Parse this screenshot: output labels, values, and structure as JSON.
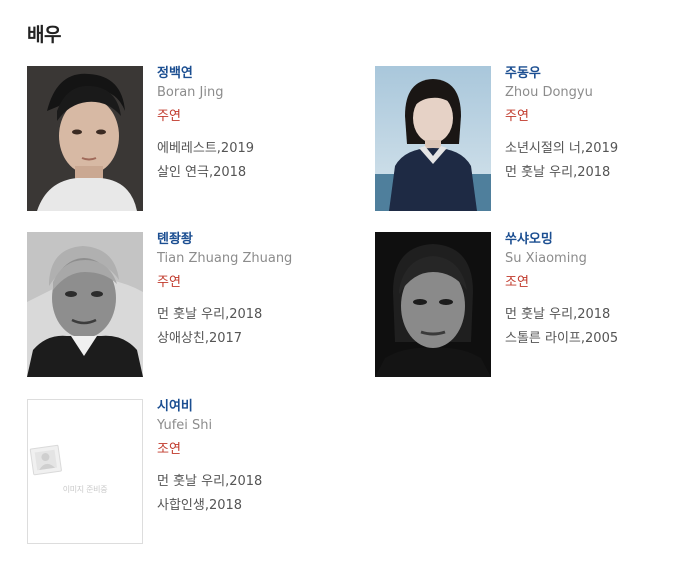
{
  "section": {
    "title": "배우"
  },
  "placeholder_caption": "이미지 준비중",
  "colors": {
    "name": "#1b4e91",
    "english_name": "#8c8c8c",
    "role": "#c0392b",
    "film": "#555555"
  },
  "actors": [
    {
      "name_ko": "정백연",
      "name_en": "Boran Jing",
      "role": "주연",
      "films": [
        "에베레스트,2019",
        "살인 연극,2018"
      ],
      "photo": "portrait-photo"
    },
    {
      "name_ko": "주동우",
      "name_en": "Zhou Dongyu",
      "role": "주연",
      "films": [
        "소년시절의 너,2019",
        "먼 훗날 우리,2018"
      ],
      "photo": "portrait-photo"
    },
    {
      "name_ko": "톈좡좡",
      "name_en": "Tian Zhuang Zhuang",
      "role": "주연",
      "films": [
        "먼 훗날 우리,2018",
        "상애상친,2017"
      ],
      "photo": "portrait-photo"
    },
    {
      "name_ko": "쑤샤오밍",
      "name_en": "Su Xiaoming",
      "role": "조연",
      "films": [
        "먼 훗날 우리,2018",
        "스톨른 라이프,2005"
      ],
      "photo": "portrait-photo"
    },
    {
      "name_ko": "시여비",
      "name_en": "Yufei Shi",
      "role": "조연",
      "films": [
        "먼 훗날 우리,2018",
        "사합인생,2018"
      ],
      "photo": "image-placeholder"
    }
  ]
}
